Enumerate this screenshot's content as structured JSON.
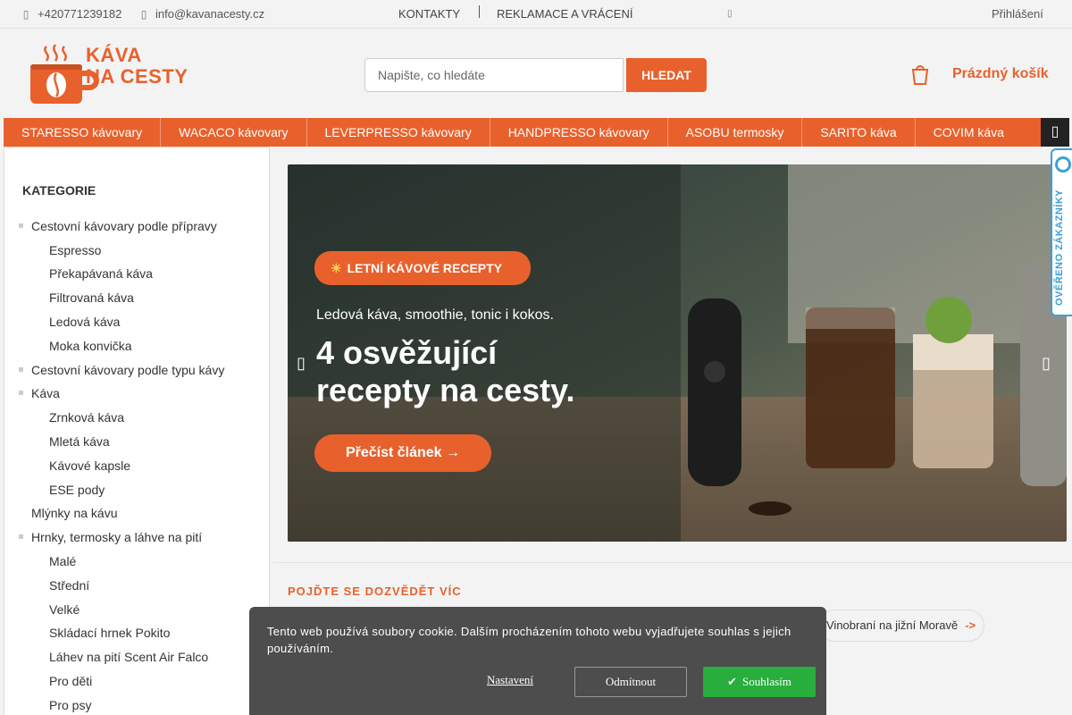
{
  "topbar": {
    "phone": "+420771239182",
    "email": "info@kavanacesty.cz",
    "contacts": "KONTAKTY",
    "returns": "REKLAMACE A VRÁCENÍ",
    "login": "Přihlášení",
    "phone_icon": "phone-icon",
    "email_icon": "envelope-icon"
  },
  "header": {
    "logo_line1": "KÁVA",
    "logo_line2": "NA CESTY",
    "search_placeholder": "Napište, co hledáte",
    "search_button": "HLEDAT",
    "cart_label": "Prázdný košík",
    "cart_icon": "cart-icon"
  },
  "nav": {
    "items": [
      "STARESSO kávovary",
      "WACACO kávovary",
      "LEVERPRESSO kávovary",
      "HANDPRESSO kávovary",
      "ASOBU termosky",
      "SARITO káva",
      "COVIM káva"
    ],
    "more_icon": "menu-icon"
  },
  "sidebar": {
    "title": "KATEGORIE",
    "items": [
      {
        "label": "Cestovní kávovary podle přípravy",
        "level": 1
      },
      {
        "label": "Espresso",
        "level": 2
      },
      {
        "label": "Překapávaná káva",
        "level": 2
      },
      {
        "label": "Filtrovaná káva",
        "level": 2
      },
      {
        "label": "Ledová káva",
        "level": 2
      },
      {
        "label": "Moka konvička",
        "level": 2
      },
      {
        "label": "Cestovní kávovary podle typu kávy",
        "level": 1
      },
      {
        "label": "Káva",
        "level": 1
      },
      {
        "label": "Zrnková káva",
        "level": 2
      },
      {
        "label": "Mletá káva",
        "level": 2
      },
      {
        "label": "Kávové kapsle",
        "level": 2
      },
      {
        "label": "ESE pody",
        "level": 2
      },
      {
        "label": "Mlýnky na kávu",
        "level": 1
      },
      {
        "label": "Hrnky, termosky a láhve na pití",
        "level": 1
      },
      {
        "label": "Malé",
        "level": 2
      },
      {
        "label": "Střední",
        "level": 2
      },
      {
        "label": "Velké",
        "level": 2
      },
      {
        "label": "Skládací hrnek Pokito",
        "level": 2
      },
      {
        "label": "Láhev na pití Scent Air Falco",
        "level": 2
      },
      {
        "label": "Pro děti",
        "level": 2
      },
      {
        "label": "Pro psy",
        "level": 2
      }
    ]
  },
  "banner": {
    "badge": "LETNÍ KÁVOVÉ RECEPTY",
    "subtitle": "Ledová káva, smoothie, tonic i kokos.",
    "headline1": "4 osvěžující",
    "headline2": "recepty na cesty.",
    "cta": "Přečíst článek →",
    "prev_icon": "chevron-left-icon",
    "next_icon": "chevron-right-icon",
    "sun_icon": "sun-icon"
  },
  "section": {
    "title": "POJĎTE SE DOZVĚDĚT VÍC",
    "chip_label": "Vinobraní na jižní Moravě",
    "chip_arrow": "->"
  },
  "verified": {
    "label": "OVĚŘENO ZÁKAZNÍKY"
  },
  "cookie": {
    "text": "Tento web používá soubory cookie. Dalším procházením tohoto webu vyjadřujete souhlas s jejich používáním.",
    "settings": "Nastavení",
    "decline": "Odmítnout",
    "accept": "Souhlasím",
    "accept_icon": "check-icon"
  },
  "colors": {
    "accent": "#e8612c",
    "accept_green": "#27ae3c",
    "cookie_bg": "#4d4d4d"
  }
}
